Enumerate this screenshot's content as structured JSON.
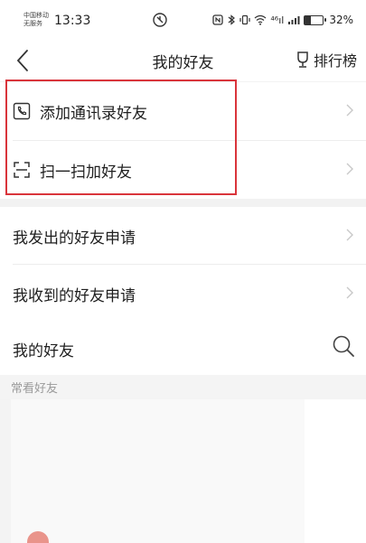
{
  "status_bar": {
    "carrier_line1": "中国移动",
    "carrier_line2": "无服务",
    "time": "13:33",
    "signal_text": "⁴⁶ıl",
    "battery_percent": "32%",
    "battery_level": 0.32
  },
  "nav": {
    "title": "我的好友",
    "rank_label": "排行榜"
  },
  "actions": [
    {
      "label": "添加通讯录好友",
      "icon": "phone-book-icon"
    },
    {
      "label": "扫一扫加好友",
      "icon": "scan-icon"
    }
  ],
  "requests": [
    {
      "label": "我发出的好友申请"
    },
    {
      "label": "我收到的好友申请"
    }
  ],
  "friends": {
    "label": "我的好友",
    "search_icon": "search-icon",
    "section_header": "常看好友"
  },
  "colors": {
    "highlight": "#d9343b",
    "section_bg": "#f4f4f4",
    "text": "#1f1f1f"
  }
}
